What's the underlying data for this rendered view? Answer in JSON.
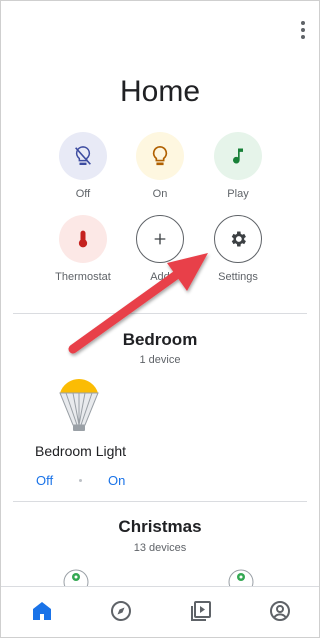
{
  "header": {
    "title": "Home"
  },
  "actions": [
    {
      "label": "Off",
      "icon": "light-off-icon",
      "bg": "#e8eaf6"
    },
    {
      "label": "On",
      "icon": "lightbulb-icon",
      "bg": "#fef7e0"
    },
    {
      "label": "Play",
      "icon": "music-note-icon",
      "bg": "#e6f4ea"
    },
    {
      "label": "Thermostat",
      "icon": "thermometer-icon",
      "bg": "#fce8e6"
    },
    {
      "label": "Add",
      "icon": "plus-icon",
      "bg": "#ffffff"
    },
    {
      "label": "Settings",
      "icon": "gear-icon",
      "bg": "#ffffff"
    }
  ],
  "rooms": [
    {
      "name": "Bedroom",
      "subtitle": "1 device"
    },
    {
      "name": "Christmas",
      "subtitle": "13 devices"
    }
  ],
  "device": {
    "name": "Bedroom Light",
    "off_label": "Off",
    "on_label": "On"
  },
  "navbar": [
    {
      "icon": "home-icon",
      "color": "#1a73e8"
    },
    {
      "icon": "compass-icon"
    },
    {
      "icon": "media-icon"
    },
    {
      "icon": "account-icon"
    }
  ],
  "colors": {
    "accent": "#1a73e8",
    "arrow": "#e8414a"
  }
}
